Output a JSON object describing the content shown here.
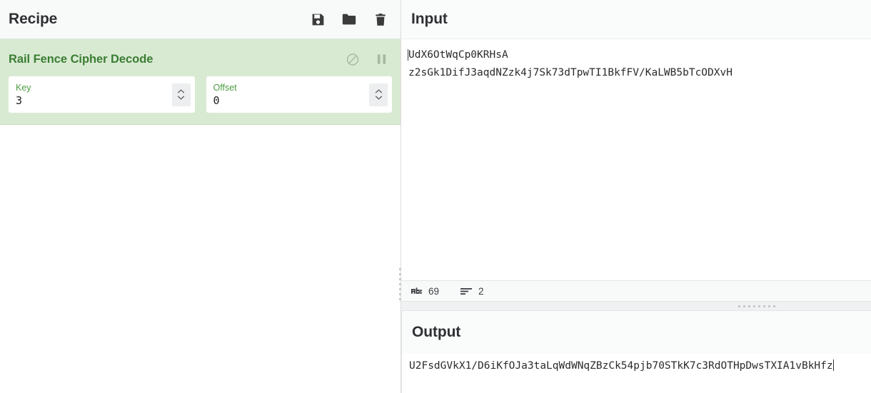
{
  "recipe": {
    "title": "Recipe",
    "controls": [
      {
        "name": "save-recipe",
        "icon": "save-icon",
        "title": "Save recipe"
      },
      {
        "name": "load-recipe",
        "icon": "folder-icon",
        "title": "Load recipe"
      },
      {
        "name": "clear-recipe",
        "icon": "trash-icon",
        "title": "Clear recipe"
      }
    ],
    "operation": {
      "name": "Rail Fence Cipher Decode",
      "disable_icon": "disable-circle-slash-icon",
      "breakpoint_icon": "pause-icon",
      "args": [
        {
          "label": "Key",
          "value": "3"
        },
        {
          "label": "Offset",
          "value": "0"
        }
      ]
    }
  },
  "input": {
    "title": "Input",
    "text_line_1": "UdX6OtWqCp0KRHsA",
    "text_line_2": "z2sGk1DifJ3aqdNZzk4j7Sk73dTpwTI1BkfFV/KaLWB5bTcODXvH",
    "status": {
      "length_icon": "abc-character-count-icon",
      "length": "69",
      "lines_icon": "line-count-icon",
      "lines": "2"
    }
  },
  "output": {
    "title": "Output",
    "text_line_1": "U2FsdGVkX1/D6iKfOJa3taLqWdWNqZBzCk54pjb70STkK7c3RdOTHpDwsTXIA1vB",
    "text_line_2": "kHfz"
  },
  "colors": {
    "operation_bg": "#d9ead3",
    "operation_title": "#3a7d32",
    "arg_label": "#4f9c45",
    "header_bg": "#f8f9f9",
    "text": "#2b2b2b"
  }
}
